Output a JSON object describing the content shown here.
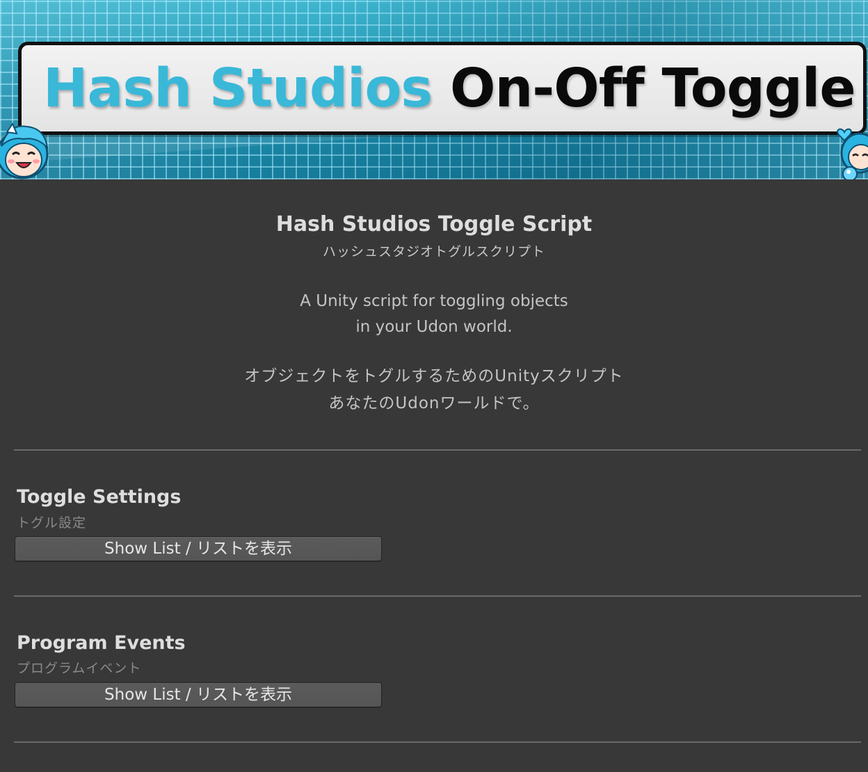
{
  "banner": {
    "brand_text": "Hash Studios",
    "product_text": "On-Off Toggle",
    "colors": {
      "brand": "#3ab8d8",
      "product": "#0a0a0a",
      "background": "#1f8fae"
    }
  },
  "header": {
    "title": "Hash Studios Toggle Script",
    "subtitle": "ハッシュスタジオトグルスクリプト",
    "description_en_line1": "A Unity script for toggling objects",
    "description_en_line2": "in your Udon world.",
    "description_jp_line1": "オブジェクトをトグルするためのUnityスクリプト",
    "description_jp_line2": "あなたのUdonワールドで。"
  },
  "toggle_settings": {
    "title": "Toggle Settings",
    "subtitle": "トグル設定",
    "button_label": "Show List / リストを表示"
  },
  "program_events": {
    "title": "Program Events",
    "subtitle": "プログラムイベント",
    "button_label": "Show List / リストを表示"
  },
  "theme": {
    "background": "#383838",
    "button_background": "#585858",
    "divider": "#6a6a6a",
    "text_primary": "#dedede",
    "text_secondary": "#8a8a8a"
  }
}
